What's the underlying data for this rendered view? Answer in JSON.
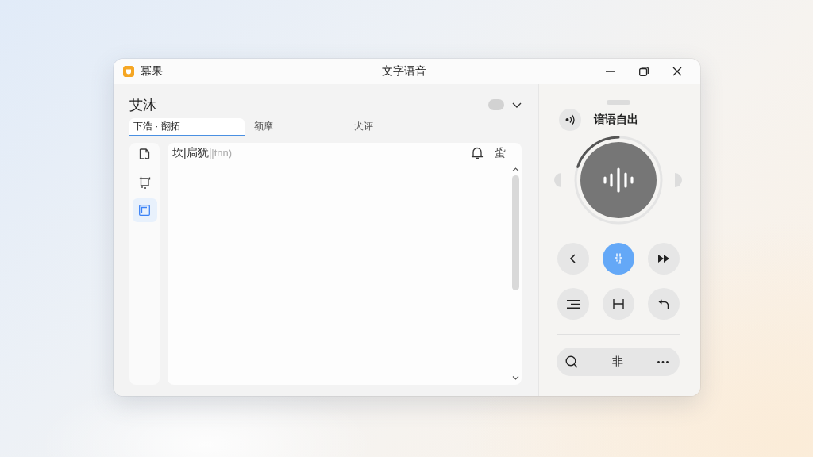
{
  "window": {
    "app_name": "冪果",
    "title": "文字语音"
  },
  "left_panel": {
    "heading": "艾沐",
    "toggle": {
      "on": false
    },
    "tabs": [
      {
        "label": "下浩 · 翻拓",
        "selected": true
      },
      {
        "label": "额摩",
        "selected": false
      },
      {
        "label": "犬评",
        "selected": false
      }
    ],
    "sidebar": {
      "items": [
        {
          "kind": "document",
          "selected": false
        },
        {
          "kind": "copy",
          "selected": false
        },
        {
          "kind": "panel",
          "selected": true
        }
      ]
    },
    "editor": {
      "input": {
        "value": "坎|扃犹|",
        "ghost_text": "|tnn)"
      },
      "side_label": "蛩"
    }
  },
  "right_panel": {
    "voice_label": "谙语自出",
    "dial": {
      "level": 0.2
    },
    "controls": [
      {
        "kind": "previous",
        "selected": false
      },
      {
        "kind": "split",
        "selected": true
      },
      {
        "kind": "fast-forward",
        "selected": false
      },
      {
        "kind": "align",
        "selected": false
      },
      {
        "kind": "fit-width",
        "selected": false
      },
      {
        "kind": "undo",
        "selected": false
      }
    ],
    "toolbar": {
      "label": "非"
    }
  }
}
